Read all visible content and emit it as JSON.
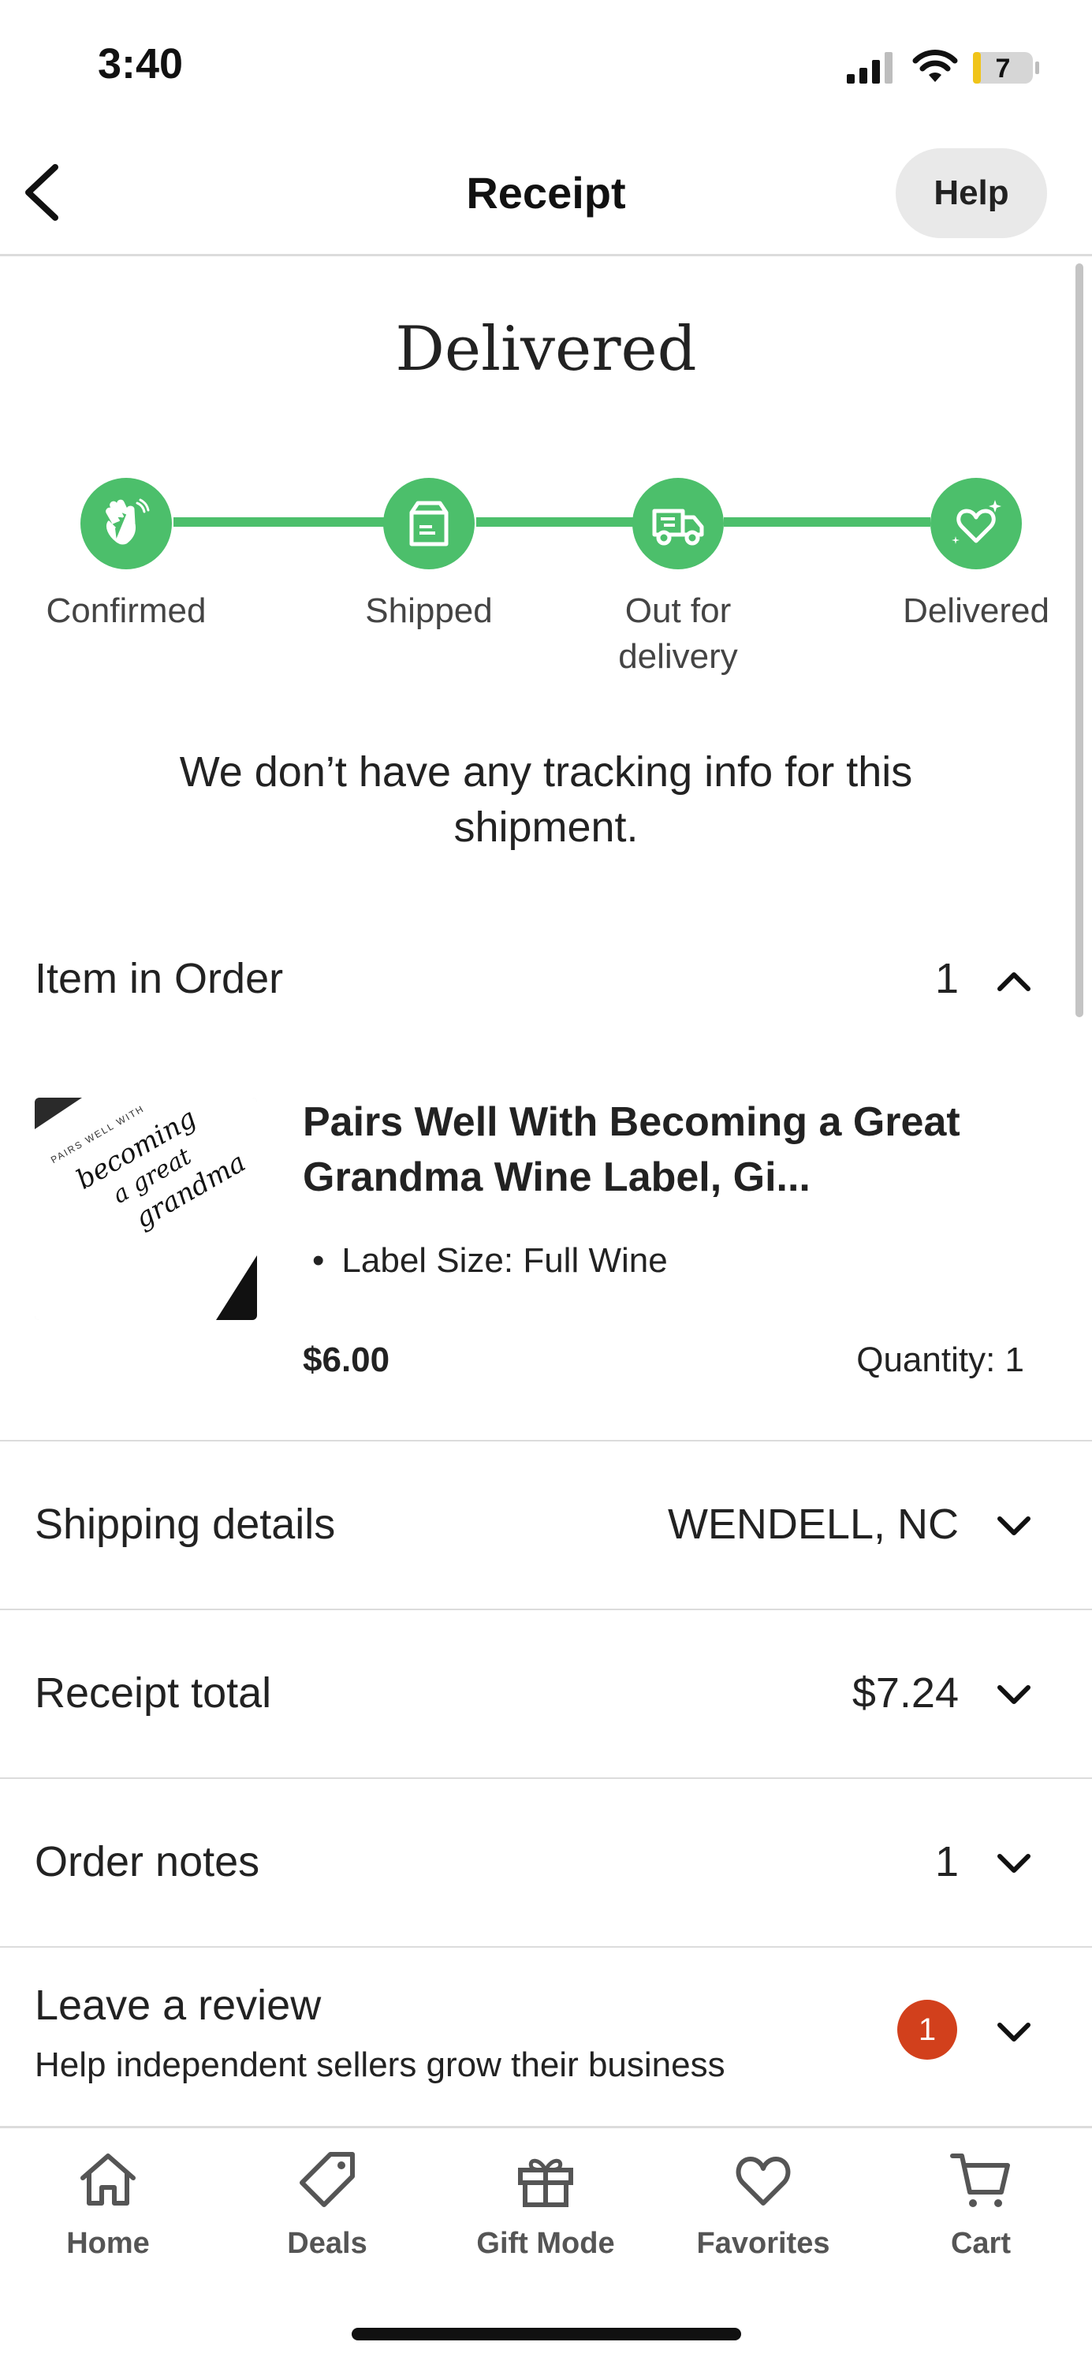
{
  "status_bar": {
    "time": "3:40",
    "battery_level": "7"
  },
  "header": {
    "title": "Receipt",
    "help_label": "Help"
  },
  "order_status": {
    "title": "Delivered",
    "steps": [
      {
        "label": "Confirmed",
        "icon": "hand-wave-icon"
      },
      {
        "label": "Shipped",
        "icon": "box-icon"
      },
      {
        "label": "Out for delivery",
        "icon": "delivery-truck-icon"
      },
      {
        "label": "Delivered",
        "icon": "heart-sparkle-icon"
      }
    ],
    "completed_steps": 4,
    "tracking_message": "We don’t have any tracking info for this shipment."
  },
  "items_section": {
    "label": "Item in Order",
    "count": "1",
    "items": [
      {
        "title": "Pairs Well With Becoming a Great Grandma Wine Label, Gi...",
        "variation": "Label Size: Full Wine",
        "price": "$6.00",
        "quantity": "Quantity: 1",
        "thumbnail": {
          "top_text": "PAIRS WELL WITH",
          "script_lines": [
            "becoming",
            "a great",
            "grandma"
          ]
        }
      }
    ]
  },
  "shipping": {
    "label": "Shipping details",
    "value": "WENDELL, NC"
  },
  "receipt_total": {
    "label": "Receipt total",
    "value": "$7.24"
  },
  "order_notes": {
    "label": "Order notes",
    "value": "1"
  },
  "review": {
    "title": "Leave a review",
    "subtitle": "Help independent sellers grow their business",
    "badge": "1"
  },
  "tab_bar": [
    {
      "label": "Home",
      "icon": "home-icon"
    },
    {
      "label": "Deals",
      "icon": "tag-icon"
    },
    {
      "label": "Gift Mode",
      "icon": "gift-icon"
    },
    {
      "label": "Favorites",
      "icon": "heart-icon"
    },
    {
      "label": "Cart",
      "icon": "cart-icon"
    }
  ],
  "colors": {
    "accent_green": "#4cbf6b",
    "badge_red": "#d2401c",
    "help_bg": "#e9e9e9"
  }
}
